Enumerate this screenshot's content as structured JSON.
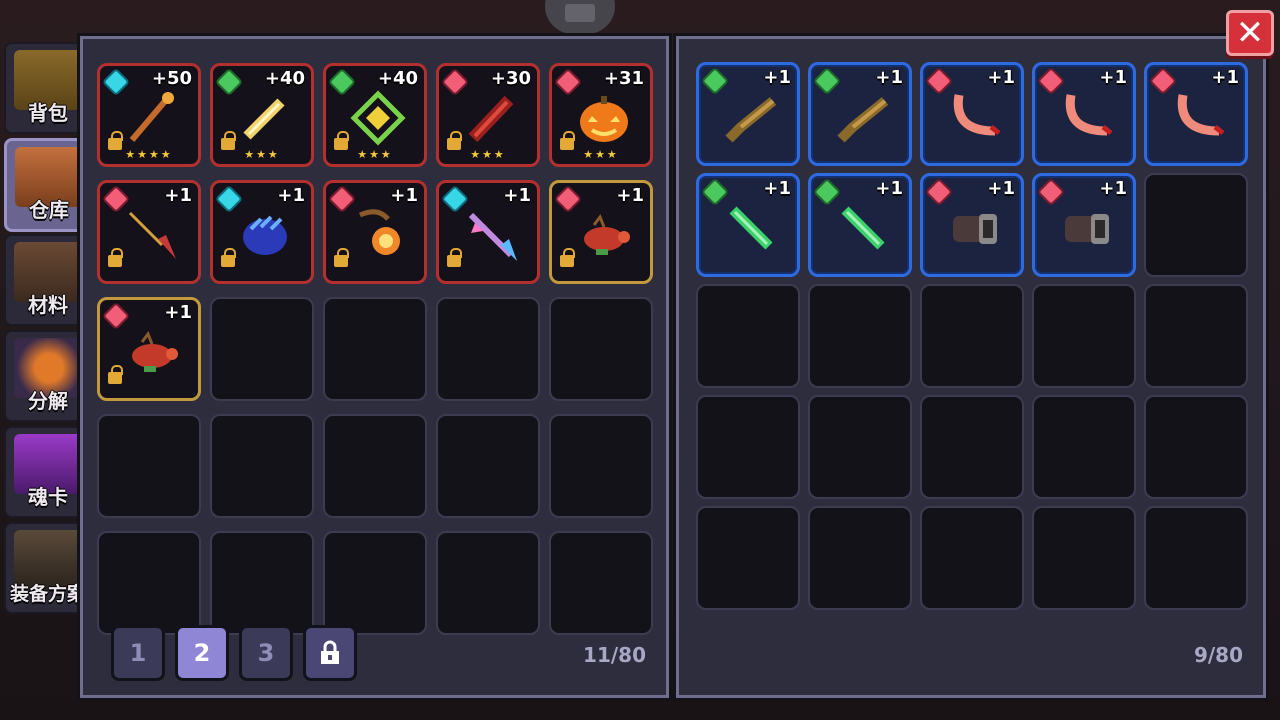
{
  "sidebar": {
    "tabs": [
      {
        "label": "背包"
      },
      {
        "label": "仓库"
      },
      {
        "label": "材料"
      },
      {
        "label": "分解"
      },
      {
        "label": "魂卡"
      },
      {
        "label": "装备方案"
      }
    ]
  },
  "left_panel": {
    "slots": [
      {
        "rarity": "red",
        "gem": "cyan",
        "level": "+50",
        "stars": "★★★★",
        "item": "staff-icon"
      },
      {
        "rarity": "red",
        "gem": "green",
        "level": "+40",
        "stars": "★★★",
        "item": "golden-sword-icon"
      },
      {
        "rarity": "red",
        "gem": "green",
        "level": "+40",
        "stars": "★★★",
        "item": "green-diamond-icon"
      },
      {
        "rarity": "red",
        "gem": "rose",
        "level": "+30",
        "stars": "★★★",
        "item": "red-greatsword-icon"
      },
      {
        "rarity": "red",
        "gem": "rose",
        "level": "+31",
        "stars": "★★★",
        "item": "pumpkin-icon"
      },
      {
        "rarity": "red",
        "gem": "rose",
        "level": "+1",
        "stars": "",
        "item": "spear-icon"
      },
      {
        "rarity": "red",
        "gem": "cyan",
        "level": "+1",
        "stars": "",
        "item": "blue-claw-icon"
      },
      {
        "rarity": "red",
        "gem": "rose",
        "level": "+1",
        "stars": "",
        "item": "lantern-icon"
      },
      {
        "rarity": "red",
        "gem": "cyan",
        "level": "+1",
        "stars": "",
        "item": "crystal-bow-icon"
      },
      {
        "rarity": "gold",
        "gem": "rose",
        "level": "+1",
        "stars": "",
        "item": "dragon-gun-icon"
      },
      {
        "rarity": "gold",
        "gem": "rose",
        "level": "+1",
        "stars": "",
        "item": "dragon-gun-icon"
      }
    ],
    "page_tabs": [
      "1",
      "2",
      "3"
    ],
    "active_page": "2",
    "count": "11/80"
  },
  "right_panel": {
    "slots": [
      {
        "gem": "green",
        "level": "+1",
        "item": "shotgun-icon"
      },
      {
        "gem": "green",
        "level": "+1",
        "item": "shotgun-icon"
      },
      {
        "gem": "rose",
        "level": "+1",
        "item": "horn-icon"
      },
      {
        "gem": "rose",
        "level": "+1",
        "item": "horn-icon"
      },
      {
        "gem": "rose",
        "level": "+1",
        "item": "horn-icon"
      },
      {
        "gem": "green",
        "level": "+1",
        "item": "green-sword-icon"
      },
      {
        "gem": "green",
        "level": "+1",
        "item": "green-sword-icon"
      },
      {
        "gem": "rose",
        "level": "+1",
        "item": "cannon-icon"
      },
      {
        "gem": "rose",
        "level": "+1",
        "item": "cannon-icon"
      }
    ],
    "count": "9/80"
  },
  "close_button": {
    "label": "✕"
  }
}
